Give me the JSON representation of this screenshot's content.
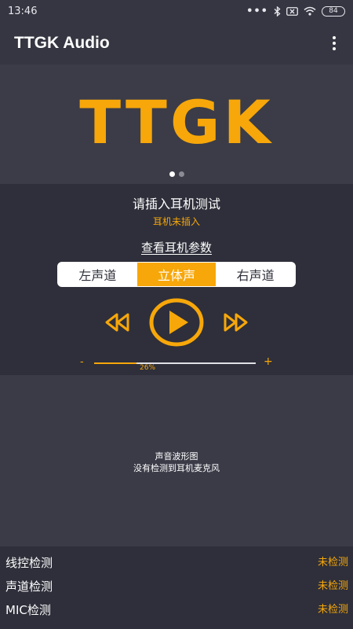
{
  "status_bar": {
    "time": "13:46",
    "dots": "•••",
    "battery": "84"
  },
  "app": {
    "title": "TTGK Audio"
  },
  "banner": {
    "logo": "TTGK",
    "pager": {
      "count": 2,
      "active": 0
    }
  },
  "panel": {
    "prompt": "请插入耳机测试",
    "headphone_status": "耳机未插入",
    "params_link": "查看耳机参数",
    "channels": [
      {
        "label": "左声道",
        "active": false
      },
      {
        "label": "立体声",
        "active": true
      },
      {
        "label": "右声道",
        "active": false
      }
    ],
    "volume": {
      "minus": "-",
      "plus": "+",
      "label": "26%",
      "level": 0.26
    }
  },
  "waveform": {
    "title": "声音波形图",
    "subtitle": "没有检测到耳机麦克风"
  },
  "checks": [
    {
      "name": "线控检测",
      "status": "未检测"
    },
    {
      "name": "声道检测",
      "status": "未检测"
    },
    {
      "name": "MIC检测",
      "status": "未检测"
    }
  ],
  "colors": {
    "accent": "#f7a70a",
    "bg": "#3a3b47",
    "panel": "#2e2f3a",
    "appbar": "#353641"
  }
}
